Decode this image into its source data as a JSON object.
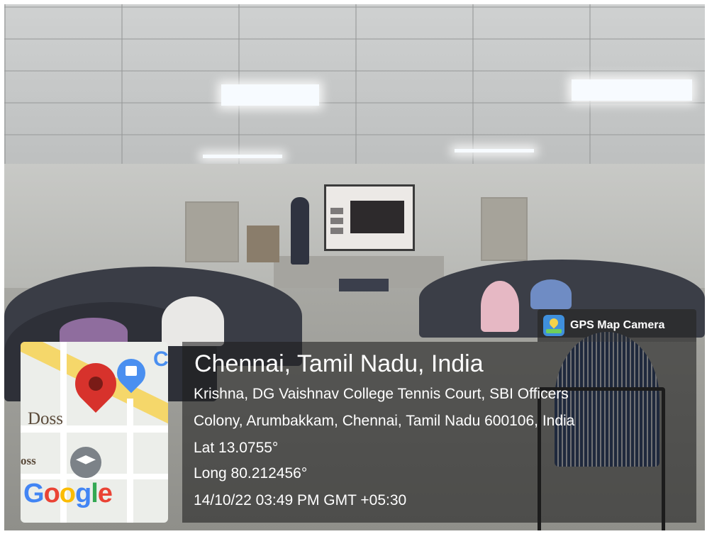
{
  "badge": {
    "icon": "gps-map-camera-icon",
    "label": "GPS Map Camera"
  },
  "map": {
    "labels": [
      "Doss",
      "oss",
      "C"
    ],
    "brand": [
      "G",
      "o",
      "o",
      "g",
      "l",
      "e"
    ],
    "icons": [
      "location-pin-icon",
      "shopping-bag-icon",
      "graduation-cap-icon"
    ]
  },
  "location": {
    "city": "Chennai, Tamil Nadu, India",
    "address_line1": "Krishna, DG Vaishnav College Tennis Court, SBI Officers",
    "address_line2": "Colony, Arumbakkam, Chennai, Tamil Nadu 600106, India",
    "lat": "Lat 13.0755°",
    "long": "Long 80.212456°",
    "datetime": "14/10/22 03:49 PM GMT +05:30"
  },
  "colors": {
    "map_pin": "#d7322c",
    "badge_icon": "#3f8fdc",
    "info_panel": "#1e1e1e"
  }
}
